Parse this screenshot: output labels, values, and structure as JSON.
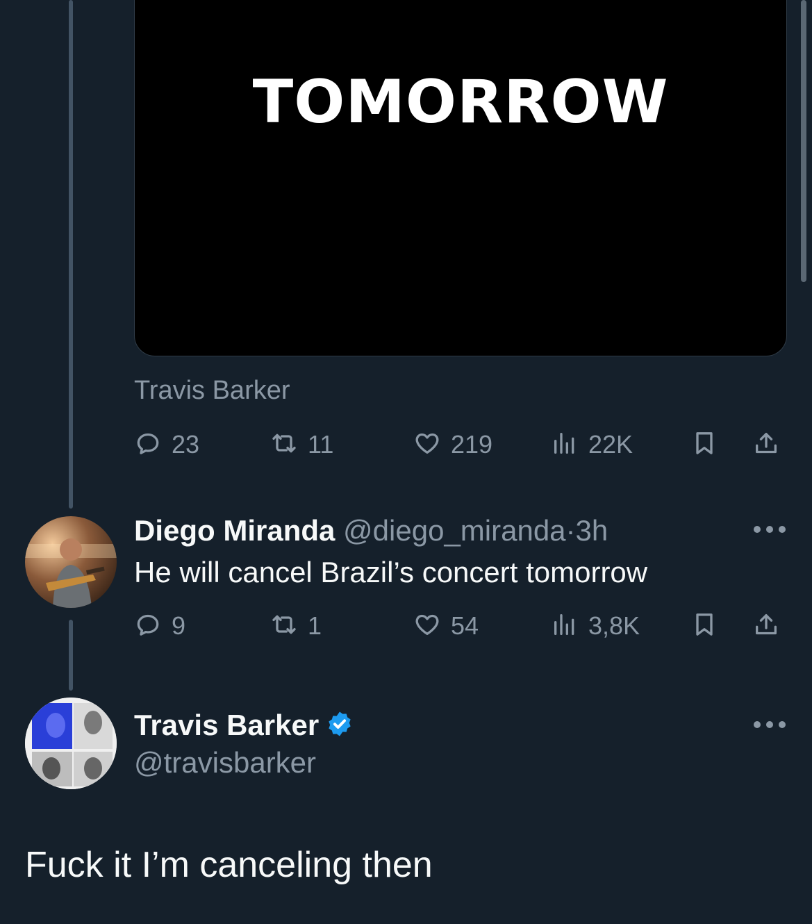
{
  "colors": {
    "background": "#15202b",
    "secondary_text": "#8b98a5",
    "primary_text": "#f7f9f9",
    "verified_blue": "#1d9bf0",
    "thread_line": "#425364"
  },
  "quoted_tweet": {
    "media_text": "TOMORROW",
    "card_caption": "Travis Barker",
    "actions": {
      "replies": "23",
      "retweets": "11",
      "likes": "219",
      "views": "22K"
    }
  },
  "reply_tweet": {
    "author_name": "Diego Miranda",
    "author_handle": "@diego_miranda",
    "separator": "·",
    "time": "3h",
    "text": "He will cancel Brazil’s concert tomorrow",
    "actions": {
      "replies": "9",
      "retweets": "1",
      "likes": "54",
      "views": "3,8K"
    }
  },
  "main_tweet": {
    "author_name": "Travis Barker",
    "author_handle": "@travisbarker",
    "verified": true,
    "text": "Fuck it I’m  canceling then"
  },
  "icons": [
    "reply-icon",
    "retweet-icon",
    "like-icon",
    "views-icon",
    "bookmark-icon",
    "share-icon",
    "more-icon",
    "verified-badge-icon"
  ]
}
